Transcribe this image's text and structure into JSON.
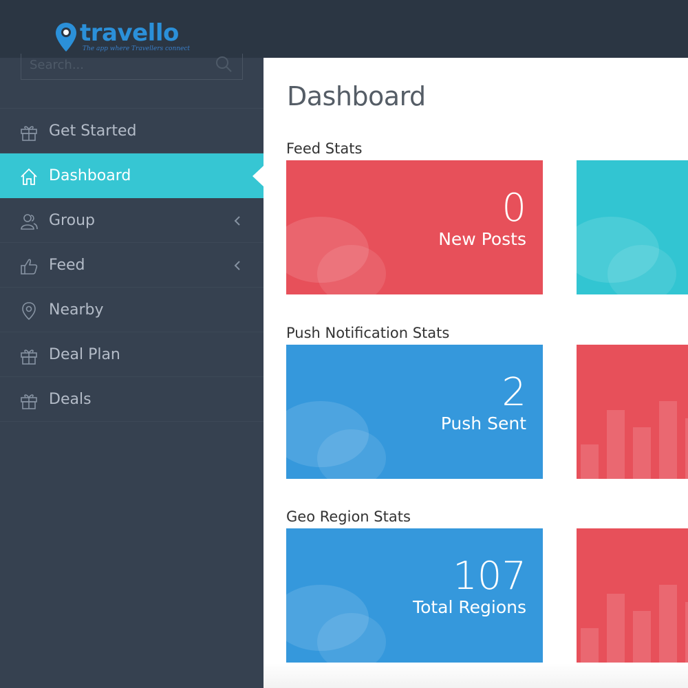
{
  "app": {
    "name": "travello",
    "tagline": "The app where Travellers connect"
  },
  "search": {
    "placeholder": "Search..."
  },
  "sidebar": {
    "items": [
      {
        "label": "Get Started",
        "icon": "gift-icon",
        "active": false,
        "has_submenu": false
      },
      {
        "label": "Dashboard",
        "icon": "home-icon",
        "active": true,
        "has_submenu": false
      },
      {
        "label": "Group",
        "icon": "users-icon",
        "active": false,
        "has_submenu": true
      },
      {
        "label": "Feed",
        "icon": "thumbs-up-icon",
        "active": false,
        "has_submenu": true
      },
      {
        "label": "Nearby",
        "icon": "map-pin-icon",
        "active": false,
        "has_submenu": false
      },
      {
        "label": "Deal Plan",
        "icon": "gift-icon",
        "active": false,
        "has_submenu": false
      },
      {
        "label": "Deals",
        "icon": "gift-icon",
        "active": false,
        "has_submenu": false
      }
    ]
  },
  "main": {
    "title": "Dashboard",
    "sections": [
      {
        "title": "Feed Stats",
        "tile": {
          "value": "0",
          "label": "New Posts",
          "color": "#e7505a"
        },
        "side_color": "#32c5d2"
      },
      {
        "title": "Push Notification Stats",
        "tile": {
          "value": "2",
          "label": "Push Sent",
          "color": "#3598dc"
        },
        "side_color": "#e7505a"
      },
      {
        "title": "Geo Region Stats",
        "tile": {
          "value": "107",
          "label": "Total Regions",
          "color": "#3598dc"
        },
        "side_color": "#e7505a"
      }
    ]
  },
  "colors": {
    "topbar": "#2b3643",
    "sidebar": "#364150",
    "accent": "#36c6d3",
    "red": "#e7505a",
    "blue": "#3598dc",
    "teal": "#32c5d2"
  }
}
